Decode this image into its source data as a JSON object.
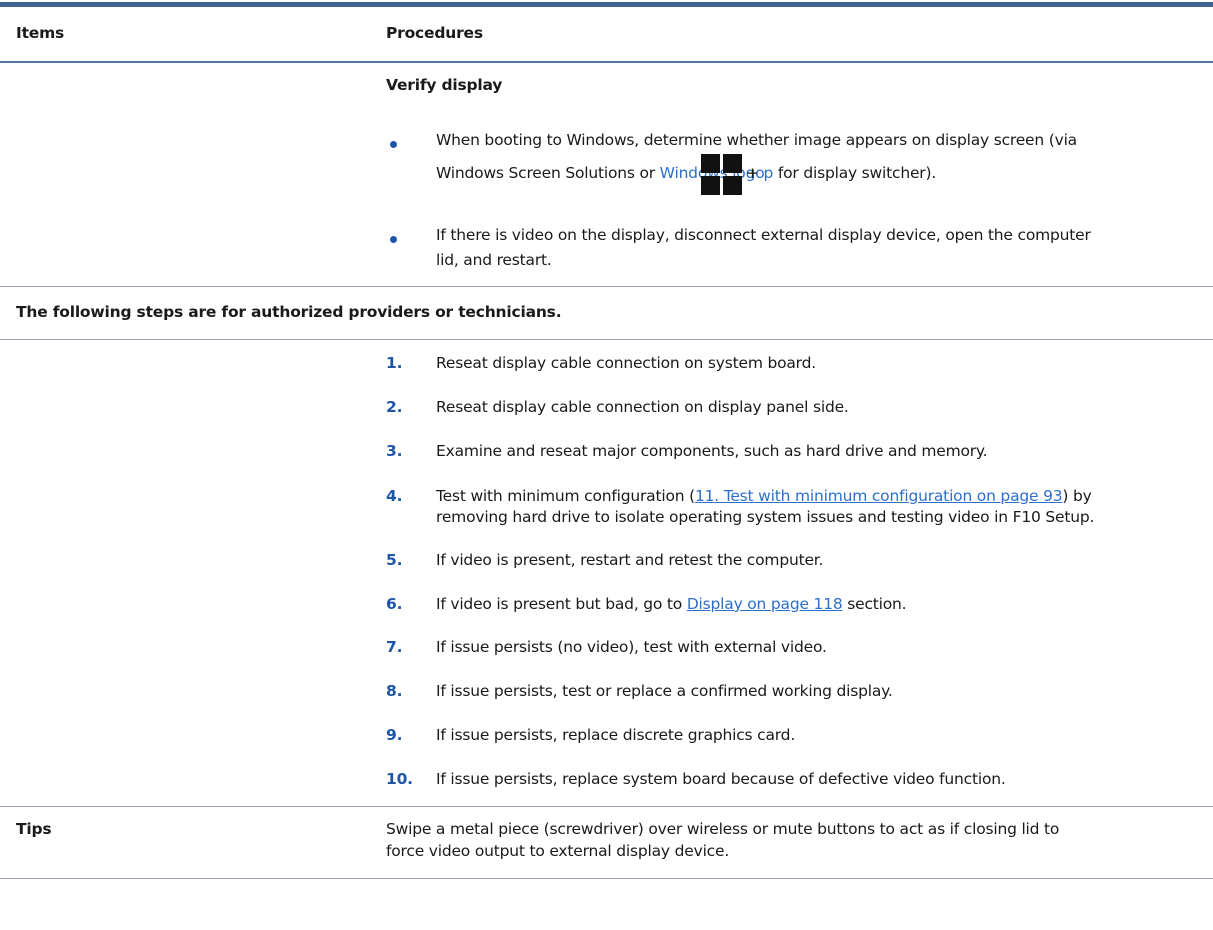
{
  "header": {
    "items": "Items",
    "procedures": "Procedures"
  },
  "verify": {
    "heading": "Verify display",
    "bullet1_line1": "When booting to Windows, determine whether image appears on display screen (via",
    "bullet1_line2_pre": "Windows Screen Solutions or ",
    "bullet1_link": "Windows logo",
    "bullet1_plus": " + ",
    "bullet1_key": "p",
    "bullet1_post": " for display switcher).",
    "windows_logo_icon": "windows-logo-icon",
    "bullet2_line1": "If there is video on the display, disconnect external display device, open the computer",
    "bullet2_line2": "lid, and restart."
  },
  "notice": "The following steps are for authorized providers or technicians.",
  "steps": [
    {
      "num": "1.",
      "text": "Reseat display cable connection on system board."
    },
    {
      "num": "2.",
      "text": "Reseat display cable connection on display panel side."
    },
    {
      "num": "3.",
      "text": "Examine and reseat major components, such as hard drive and memory."
    },
    {
      "num": "4.",
      "pre": "Test with minimum configuration (",
      "link": "11. Test with minimum configuration on page 93",
      "post": ") by",
      "line2": "removing hard drive to isolate operating system issues and testing video in F10 Setup."
    },
    {
      "num": "5.",
      "text": "If video is present, restart and retest the computer."
    },
    {
      "num": "6.",
      "pre": "If video is present but bad, go to ",
      "link": "Display on page 118",
      "post": " section."
    },
    {
      "num": "7.",
      "text": "If issue persists (no video), test with external video."
    },
    {
      "num": "8.",
      "text": "If issue persists, test or replace a confirmed working display."
    },
    {
      "num": "9.",
      "text": "If issue persists, replace discrete graphics card."
    },
    {
      "num": "10.",
      "text": "If issue persists, replace system board because of defective video function."
    }
  ],
  "tips": {
    "label": "Tips",
    "line1": "Swipe a metal piece (screwdriver) over wireless or mute buttons to act as if closing lid to",
    "line2": "force video output to external display device."
  },
  "colors": {
    "accent": "#1f56a8",
    "link": "#2e6fc9",
    "rule": "#40648f"
  }
}
